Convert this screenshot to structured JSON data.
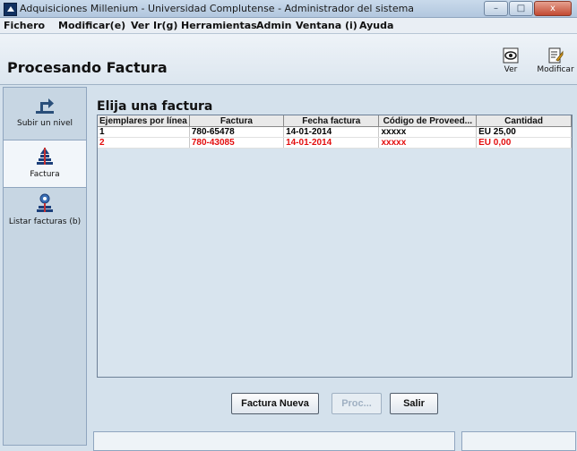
{
  "window": {
    "title": "Adquisiciones Millenium - Universidad Complutense - Administrador del sistema",
    "minimize_glyph": "–",
    "maximize_glyph": "□",
    "close_glyph": "x"
  },
  "menu": [
    "Fichero",
    "Modificar(e)",
    "Ver",
    "Ir(g)",
    "Herramientas",
    "Admin",
    "Ventana (i)",
    "Ayuda"
  ],
  "header": {
    "title": "Procesando Factura",
    "tools": [
      {
        "label": "Ver",
        "icon": "view-icon"
      },
      {
        "label": "Modificar",
        "icon": "edit-icon"
      }
    ]
  },
  "sidebar": {
    "items": [
      {
        "label": "Subir un nivel",
        "icon": "up-level-icon"
      },
      {
        "label": "Factura",
        "icon": "invoice-icon"
      },
      {
        "label": "Listar facturas (b)",
        "icon": "list-invoices-icon"
      }
    ]
  },
  "main": {
    "title": "Elija una factura",
    "columns": [
      "Ejemplares por línea",
      "Factura",
      "Fecha factura",
      "Código de Proveed...",
      "Cantidad"
    ],
    "rows": [
      {
        "cells": [
          "1",
          "780-65478",
          "14-01-2014",
          "xxxxx",
          "EU 25,00"
        ],
        "color": "#000000"
      },
      {
        "cells": [
          "2",
          "780-43085",
          "14-01-2014",
          "xxxxx",
          "EU 0,00"
        ],
        "color": "#e30d0d"
      }
    ],
    "buttons": {
      "new_invoice": "Factura Nueva",
      "process": "Proc...",
      "exit": "Salir"
    }
  },
  "colors": {
    "background": "#d4e1ec",
    "highlight_row": "#e30d0d"
  }
}
